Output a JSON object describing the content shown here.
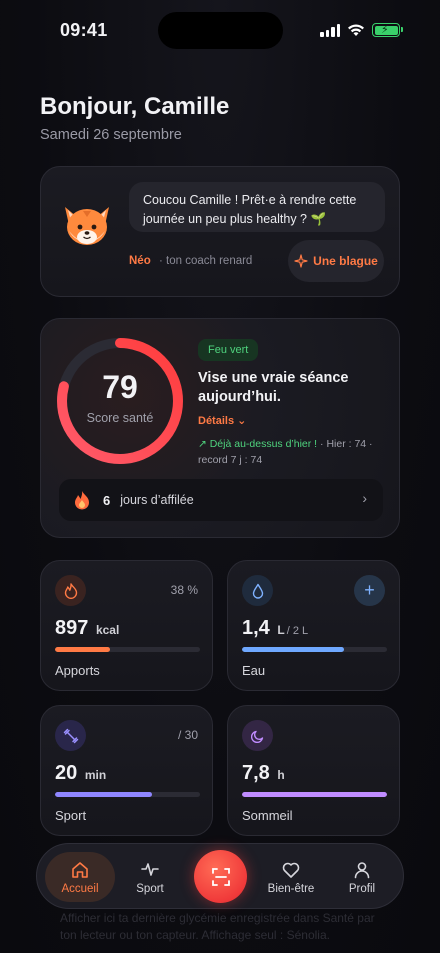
{
  "status_bar": {
    "time": "09:41"
  },
  "header": {
    "greeting": "Bonjour, Camille",
    "date": "Samedi 26 septembre"
  },
  "coach": {
    "message": "Coucou Camille ! Prêt·e à rendre cette journée un peu plus healthy ? 🌱",
    "name": "Néo",
    "role": "· ton coach renard",
    "joke_button": "Une blague"
  },
  "score": {
    "value": "79",
    "label": "Score santé",
    "progress": 0.79,
    "badge": "Feu vert",
    "advice": "Vise une vraie séance aujourd’hui.",
    "details_link": "Détails",
    "trend_highlight": "↗ Déjà au-dessus d’hier !",
    "trend_detail": " · Hier : 74 · record 7 j : 74",
    "streak_count": "6",
    "streak_label": "jours d’affilée"
  },
  "tiles": {
    "apports": {
      "meta": "38 %",
      "value": "897",
      "unit": "kcal",
      "label": "Apports",
      "progress": 0.38,
      "color": "#ff7a45"
    },
    "eau": {
      "value": "1,4",
      "unit": "L",
      "target": "/ 2 L",
      "label": "Eau",
      "progress": 0.7,
      "color": "#6fa8ff",
      "add_label": "+"
    },
    "sport": {
      "meta": "/ 30",
      "value": "20",
      "unit": "min",
      "label": "Sport",
      "progress": 0.67,
      "color": "#8f86ff"
    },
    "sommeil": {
      "value": "7,8",
      "unit": "h",
      "label": "Sommeil",
      "progress": 1.0,
      "color": "#c08cff"
    }
  },
  "background_text": "Afficher ici ta dernière glycémie enregistrée dans Santé par ton lecteur ou ton capteur. Affichage seul : Sénolia.",
  "tabbar": {
    "items": [
      {
        "label": "Accueil",
        "icon": "home-icon"
      },
      {
        "label": "Sport",
        "icon": "activity-icon"
      },
      {
        "label": "Bien-être",
        "icon": "heart-icon"
      },
      {
        "label": "Profil",
        "icon": "user-icon"
      }
    ],
    "scan_icon": "scan-icon"
  },
  "colors": {
    "accent": "#ff7a45",
    "green": "#4fd37e",
    "ring_start": "#ff3d3d",
    "ring_end": "#ff7a7a"
  }
}
